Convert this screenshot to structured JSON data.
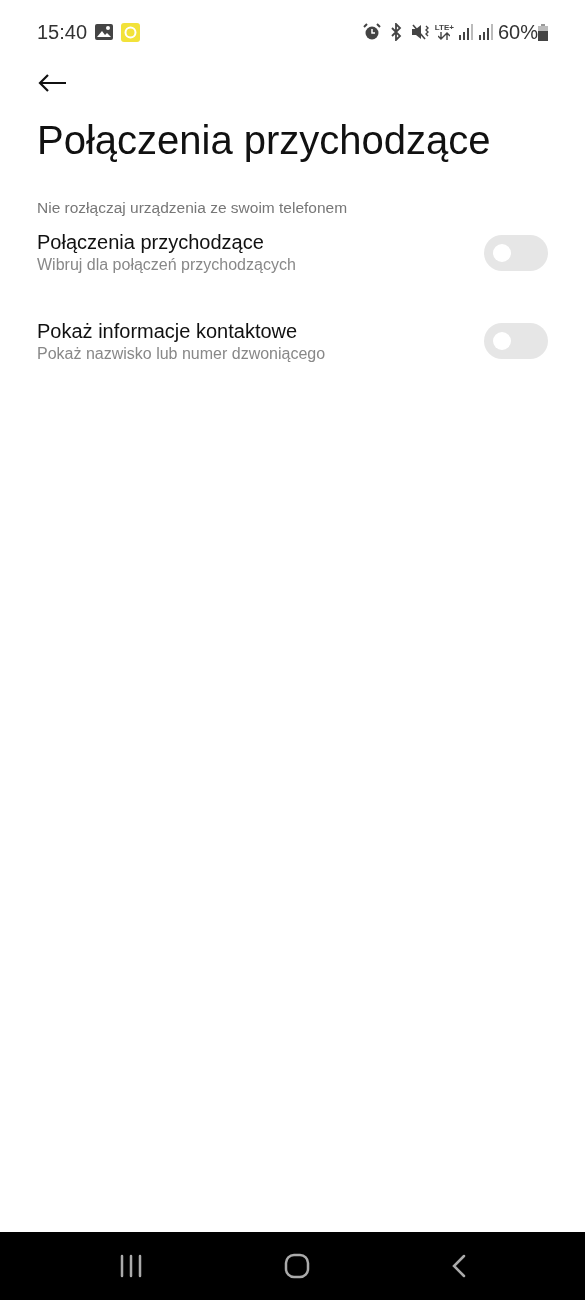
{
  "status_bar": {
    "time": "15:40",
    "network": "LTE+",
    "battery": "60%"
  },
  "title": "Połączenia przychodzące",
  "section_hint": "Nie rozłączaj urządzenia ze swoim telefonem",
  "settings": [
    {
      "label": "Połączenia przychodzące",
      "description": "Wibruj dla połączeń przychodzących",
      "on": false
    },
    {
      "label": "Pokaż informacje kontaktowe",
      "description": "Pokaż nazwisko lub numer dzwoniącego",
      "on": false
    }
  ]
}
